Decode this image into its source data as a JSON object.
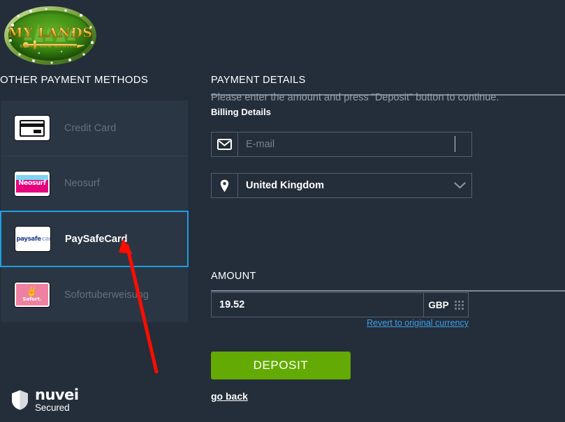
{
  "brand": {
    "logo_alt": "My Lands",
    "logo_title": "MY LANDS",
    "logo_subtitle": "BLACK GEM HUNTING"
  },
  "sidebar": {
    "title": "OTHER PAYMENT METHODS",
    "items": [
      {
        "label": "Credit Card",
        "icon": "credit-card-icon",
        "selected": false
      },
      {
        "label": "Neosurf",
        "icon": "neosurf-icon",
        "selected": false
      },
      {
        "label": "PaySafeCard",
        "icon": "paysafecard-icon",
        "selected": true
      },
      {
        "label": "Sofortuberweisung",
        "icon": "sofort-icon",
        "selected": false
      }
    ],
    "neosurf_wordmark": "Neosurf",
    "paysafe_word_a": "paysafe",
    "paysafe_word_b": "card",
    "sofort_wordmark": "Sofort.",
    "footer": {
      "name": "nuvei",
      "subtitle": "Secured",
      "icon": "shield-icon"
    }
  },
  "payment_details": {
    "title": "PAYMENT DETAILS",
    "instruction": "Please enter the amount and press \"Deposit\" button to continue.",
    "billing_label": "Billing Details",
    "email": {
      "value": "",
      "placeholder": "E-mail",
      "icon": "envelope-icon"
    },
    "country": {
      "value": "United Kingdom",
      "icon": "map-pin-icon",
      "chevron": "chevron-down-icon"
    }
  },
  "amount": {
    "title": "AMOUNT",
    "value": "19.52",
    "placeholder": "",
    "currency": "GBP",
    "currency_icon": "grid-icon",
    "revert_link": "Revert to original currency"
  },
  "actions": {
    "deposit_label": "DEPOSIT",
    "go_back_label": "go back"
  },
  "colors": {
    "page_background": "#242d3a",
    "card_background": "#2b3645",
    "selected_border": "#1ba0e0",
    "rule": "#7c8899",
    "link": "#3ba0e8",
    "deposit_green": "#64aa04",
    "annotation_red": "#fc0d00",
    "muted_text": "#656f7e"
  }
}
